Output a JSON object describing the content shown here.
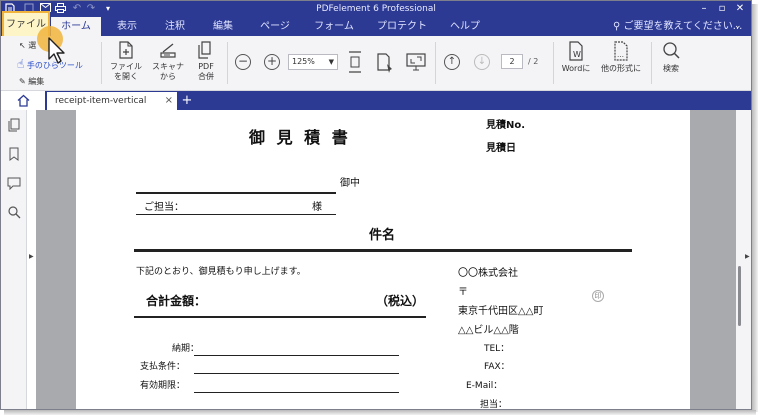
{
  "app": {
    "title": "PDFelement 6 Professional"
  },
  "menu": {
    "items": [
      "ファイル",
      "ホーム",
      "表示",
      "注釈",
      "編集",
      "ページ",
      "フォーム",
      "プロテクト",
      "ヘルプ"
    ],
    "help_search": "ご要望を教えてください..."
  },
  "ribbon": {
    "select_label": "選",
    "hand_tool": "手のひらツール",
    "edit": "編集",
    "open_file": [
      "ファイル",
      "を開く"
    ],
    "from_scanner": [
      "スキャナ",
      "から"
    ],
    "pdf_combine": [
      "PDF",
      "合併"
    ],
    "zoom": "125%",
    "page_current": "2",
    "page_total": "/ 2",
    "to_word": "Wordに",
    "to_other": "他の形式に",
    "search": "検索"
  },
  "tabs": {
    "doc_title": "receipt-item-vertical",
    "close": "×",
    "add": "+"
  },
  "document": {
    "title": "御 見 積 書",
    "estimate_no": "見積No.",
    "estimate_date": "見積日",
    "recipient_suffix": "御中",
    "person_in_charge": "ご担当：",
    "sama": "様",
    "subject": "件名",
    "intro": "下記のとおり、御見積もり申し上げます。",
    "total_label": "合計金額：",
    "tax_included": "（税込）",
    "delivery_label": "納期：",
    "payment_label": "支払条件：",
    "validity_label": "有効期限：",
    "company_name": "〇〇株式会社",
    "postal_mark": "〒",
    "address_1": "東京千代田区△△町",
    "address_2": "△△ビル△△階",
    "tel": "TEL：",
    "fax": "FAX：",
    "email": "E-Mail：",
    "contact": "担当：",
    "seal": "印"
  },
  "colors": {
    "brand": "#2c3a94",
    "highlight_border": "#f0b43c",
    "highlight_fill": "#fdf4c7"
  }
}
